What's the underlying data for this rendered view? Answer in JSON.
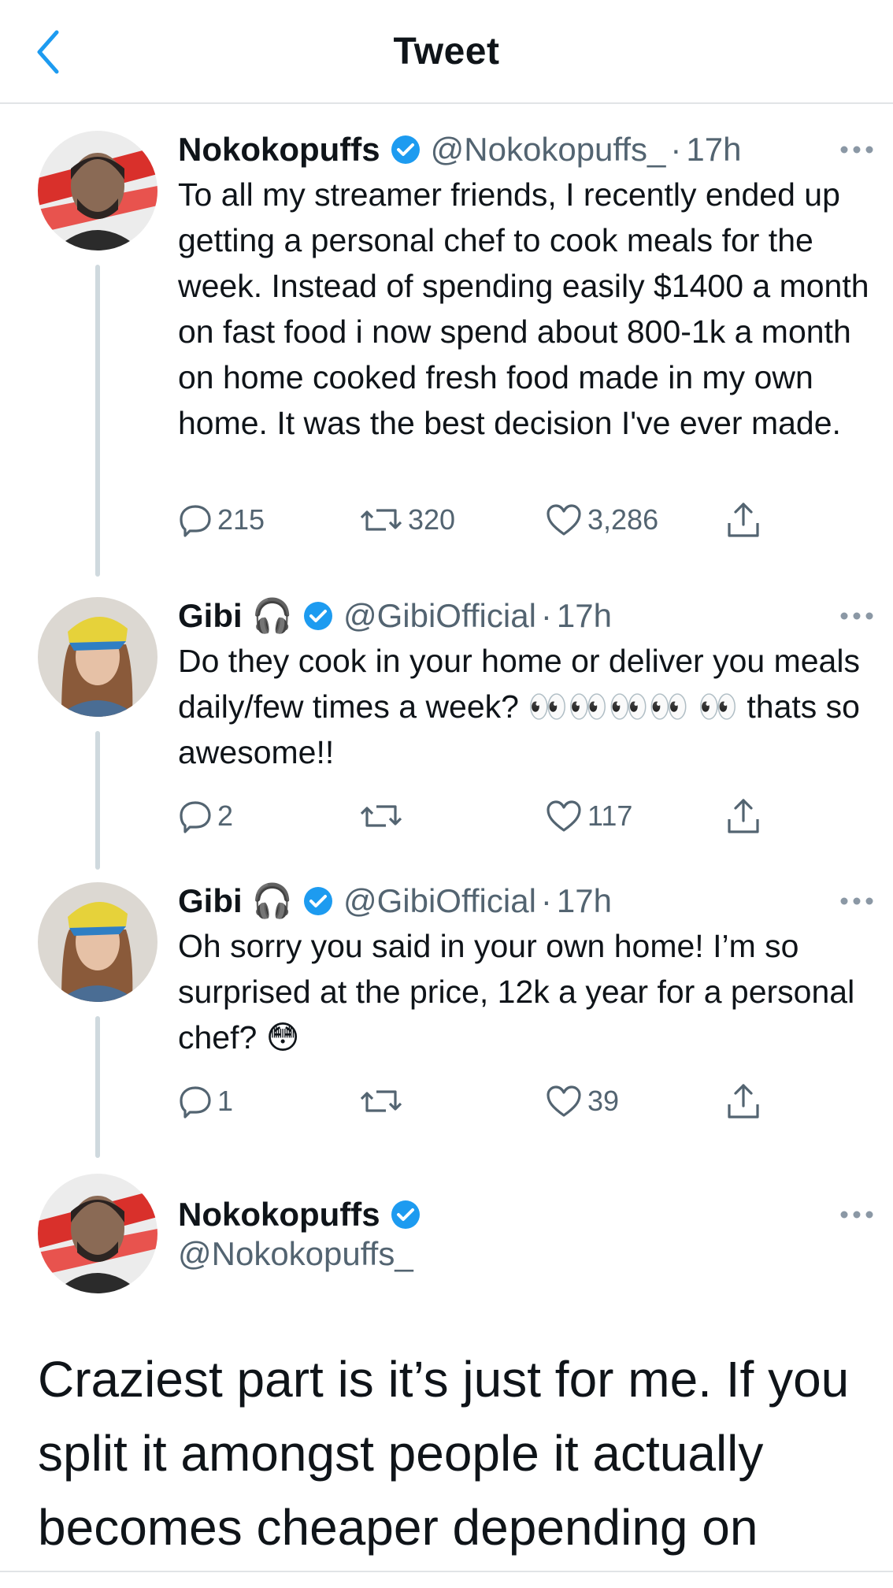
{
  "header": {
    "title": "Tweet"
  },
  "thread": [
    {
      "display_name": "Nokokopuffs",
      "verified": true,
      "handle": "@Nokokopuffs_",
      "separator": "·",
      "time": "17h",
      "text": "To all my streamer friends, I recently ended up getting a personal chef to cook meals for the week. Instead of spending easily $1400 a month on fast food i now spend about 800-1k a month on home cooked fresh food made in my own home. It was the best decision I've ever made.",
      "replies": "215",
      "retweets": "320",
      "likes": "3,286"
    },
    {
      "display_name": "Gibi",
      "name_emoji": "🎧",
      "verified": true,
      "handle": "@GibiOfficial",
      "separator": "·",
      "time": "17h",
      "text": "Do they cook in your home or deliver you meals daily/few times a week? 👀👀👀👀 👀 thats so awesome!!",
      "replies": "2",
      "retweets": "",
      "likes": "117"
    },
    {
      "display_name": "Gibi",
      "name_emoji": "🎧",
      "verified": true,
      "handle": "@GibiOfficial",
      "separator": "·",
      "time": "17h",
      "text": "Oh sorry you said in your own home! I’m so surprised at the price, 12k a year for a personal chef? 😳",
      "replies": "1",
      "retweets": "",
      "likes": "39"
    }
  ],
  "main_tweet": {
    "display_name": "Nokokopuffs",
    "verified": true,
    "handle": "@Nokokopuffs_",
    "text": "Craziest part is it’s just for me. If you split it amongst people it actually becomes cheaper depending on"
  },
  "colors": {
    "verified_blue": "#1d9bf0",
    "icon_gray": "#536471",
    "thread_line": "#cfd9de"
  },
  "icons": {
    "back": "chevron-left-icon",
    "reply": "speech-bubble-icon",
    "retweet": "retweet-icon",
    "like": "heart-icon",
    "share": "share-upload-icon",
    "more": "ellipsis-icon",
    "verified": "verified-badge-icon"
  }
}
